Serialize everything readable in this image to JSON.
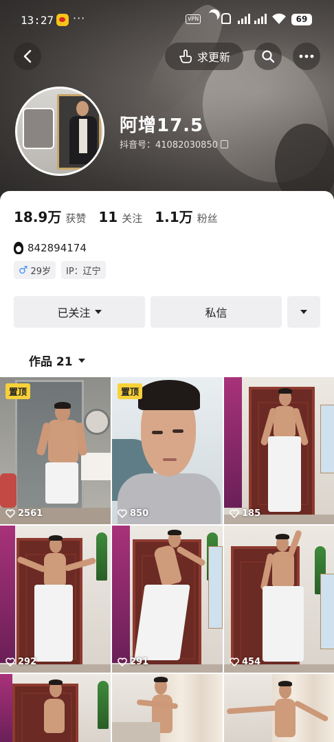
{
  "status_bar": {
    "time": "13:27",
    "more": "···",
    "vpn": "VPN",
    "battery": "69"
  },
  "header": {
    "request_update_label": "求更新",
    "nickname": "阿增17.5",
    "douyin_id": "抖音号：41082030850"
  },
  "stats": [
    {
      "value": "18.9万",
      "label": "获赞"
    },
    {
      "value": "11",
      "label": "关注"
    },
    {
      "value": "1.1万",
      "label": "粉丝"
    }
  ],
  "profile": {
    "qq": "842894174",
    "gender_age": "29岁",
    "ip": "IP：辽宁"
  },
  "actions": {
    "follow_label": "已关注",
    "message_label": "私信"
  },
  "tabs": {
    "works_label": "作品 21"
  },
  "videos": [
    {
      "pinned": "置顶",
      "likes": "2561"
    },
    {
      "pinned": "置顶",
      "likes": "850"
    },
    {
      "pinned": "",
      "likes": "185"
    },
    {
      "pinned": "",
      "likes": "292"
    },
    {
      "pinned": "",
      "likes": "291"
    },
    {
      "pinned": "",
      "likes": "454"
    },
    {
      "pinned": "",
      "likes": ""
    },
    {
      "pinned": "",
      "likes": ""
    },
    {
      "pinned": "",
      "likes": ""
    }
  ],
  "colors": {
    "pin_badge": "#f8d13a",
    "gender_male": "#3e8ef7",
    "button_bg": "#efeff1"
  },
  "icons": [
    "back-icon",
    "hand-point-icon",
    "search-icon",
    "more-icon",
    "copy-icon",
    "qq-icon",
    "male-icon",
    "dropdown-icon",
    "heart-icon"
  ]
}
